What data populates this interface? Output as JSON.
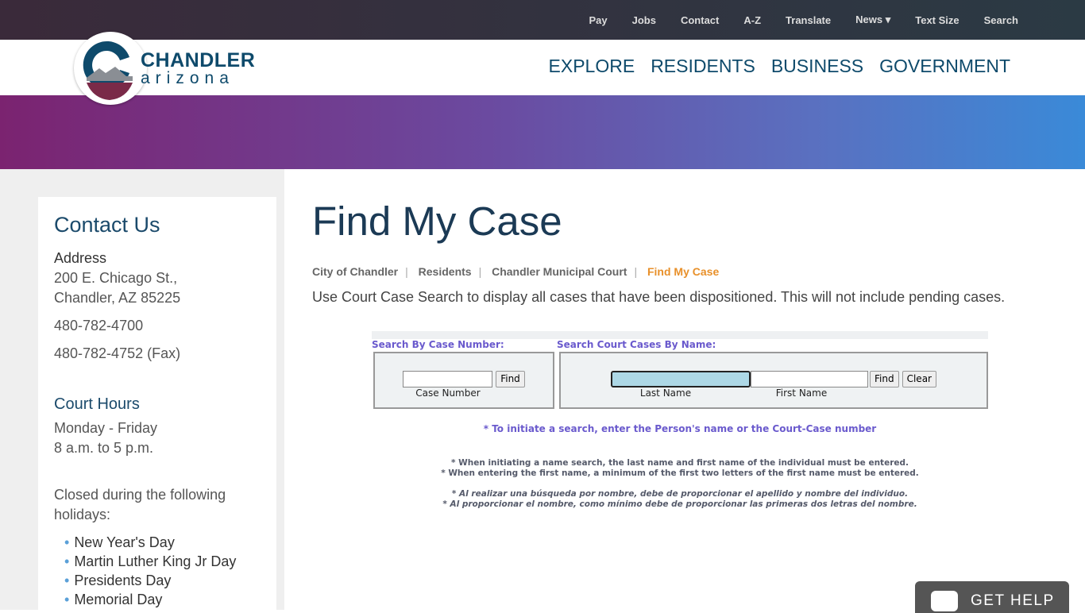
{
  "topnav": [
    "Pay",
    "Jobs",
    "Contact",
    "A-Z",
    "Translate",
    "News ▾",
    "Text Size",
    "Search"
  ],
  "logo": {
    "line1": "CHANDLER",
    "line2": "arizona"
  },
  "mainnav": [
    "EXPLORE",
    "RESIDENTS",
    "BUSINESS",
    "GOVERNMENT"
  ],
  "sidebar": {
    "title": "Contact Us",
    "address_label": "Address",
    "address1": "200 E. Chicago St.,",
    "address2": "Chandler, AZ 85225",
    "phone": "480-782-4700",
    "fax": "480-782-4752 (Fax)",
    "hours_title": "Court Hours",
    "hours1": "Monday - Friday",
    "hours2": "8 a.m. to 5 p.m.",
    "closed": "Closed during the following holidays:",
    "holidays": [
      "New Year's Day",
      "Martin Luther King Jr Day",
      "Presidents Day",
      "Memorial Day"
    ]
  },
  "page": {
    "title": "Find My Case",
    "breadcrumb": [
      "City of Chandler",
      "Residents",
      "Chandler Municipal Court",
      "Find My Case"
    ],
    "intro": "Use Court Case Search to display all cases that have been dispositioned. This will not include pending cases."
  },
  "form": {
    "case_heading": "Search By Case Number:",
    "name_heading": "Search Court Cases By Name:",
    "find": "Find",
    "clear": "Clear",
    "case_label": "Case Number",
    "last_label": "Last Name",
    "first_label": "First Name",
    "note": "* To initiate a search, enter the Person's name or the Court-Case number",
    "en1": "* When initiating a name search, the last name and first name of the individual must be entered.",
    "en2": "* When entering the first name, a minimum of the first two letters of the first name must be entered.",
    "es1": "* Al realizar una búsqueda por nombre, debe de proporcionar el apellido y nombre del individuo.",
    "es2": "* Al proporcionar el nombre, como mínimo debe de proporcionar las primeras dos letras del nombre."
  },
  "help": {
    "label": "GET HELP"
  }
}
